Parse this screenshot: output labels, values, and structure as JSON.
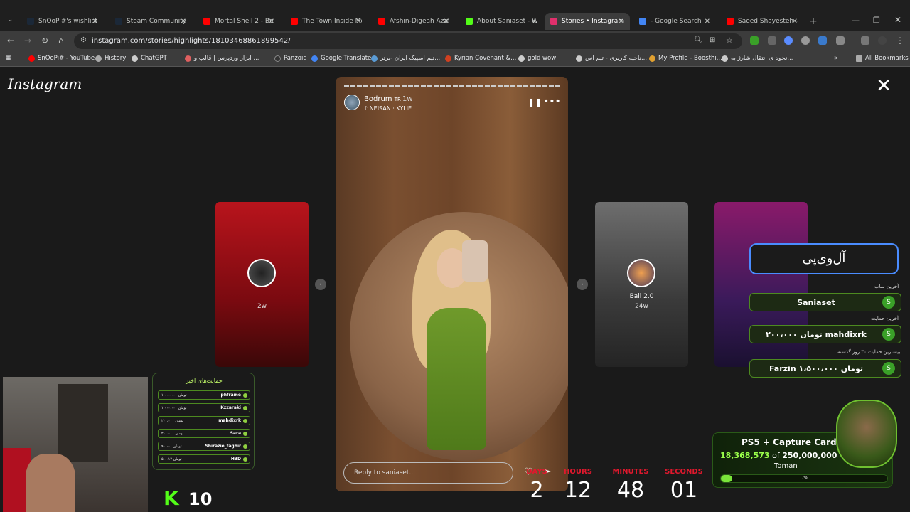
{
  "tabs": [
    {
      "label": "SnOoPi#'s wishlist",
      "color": "#1b2838"
    },
    {
      "label": "Steam Community ::",
      "color": "#1b2838"
    },
    {
      "label": "Mortal Shell 2 - Befo",
      "color": "#ff0000"
    },
    {
      "label": "The Town Inside Me |",
      "color": "#ff0000"
    },
    {
      "label": "Afshin-Digeah Azat B",
      "color": "#ff0000"
    },
    {
      "label": "About Saniaset - Wa",
      "color": "#53fc18"
    },
    {
      "label": "Stories • Instagram",
      "color": "#e1306c"
    },
    {
      "label": "- Google Search",
      "color": "#4285f4"
    },
    {
      "label": "Saeed Shayesteh - S",
      "color": "#ff0000"
    }
  ],
  "address": {
    "url": "instagram.com/stories/highlights/18103468861899542/"
  },
  "bookmarks": [
    {
      "label": "SnOoPi# - YouTube",
      "color": "#ff0000"
    },
    {
      "label": "History",
      "color": "#aaaaaa"
    },
    {
      "label": "ChatGPT",
      "color": "#cccccc"
    },
    {
      "label": "ابزار وردپرس | قالب و ...",
      "color": "#e06060"
    },
    {
      "label": "Panzoid",
      "color": "#333333"
    },
    {
      "label": "Google Translate",
      "color": "#4285f4"
    },
    {
      "label": "تیم اسپیک ایران -برتر...",
      "color": "#5a9bd5"
    },
    {
      "label": "Kyrian Covenant &...",
      "color": "#d04020"
    },
    {
      "label": "gold wow",
      "color": "#cccccc"
    },
    {
      "label": "ناحیه کاربری - تیم اس...",
      "color": "#cccccc"
    },
    {
      "label": "My Profile - Boosthi...",
      "color": "#e0a030"
    },
    {
      "label": "نحوه ی انتقال شارژ به...",
      "color": "#cccccc"
    }
  ],
  "all_bookmarks": "All Bookmarks",
  "instagram": {
    "logo": "Instagram",
    "story": {
      "username": "Bodrum",
      "flag": "TR",
      "time": "1w",
      "music": "NEISAN · KYLIE",
      "reply_placeholder": "Reply to saniaset..."
    },
    "left_story": {
      "time": "2w"
    },
    "right_story": {
      "name": "Bali 2.0",
      "time": "24w"
    }
  },
  "overlay": {
    "title": "آل‌وی‌پی",
    "last_sub_label": "آخرین ساب",
    "last_sub": "Saniaset",
    "last_donation_label": "آخرین حمایت",
    "last_donation": "۲۰۰،۰۰۰ تومان  mahdixrk",
    "top_donation_label": "بیشترین حمایت ۳۰ روز گذشته",
    "top_donation": "Farzin  ۱،۵۰۰،۰۰۰ تومان",
    "recent_title": "حمایت‌های اخیر",
    "recent": [
      {
        "name": "phframe",
        "amount": "۱،۰۰۰،۰۰۰ تومان"
      },
      {
        "name": "Kzzaraki",
        "amount": "۱،۰۰۰،۰۰۰ تومان"
      },
      {
        "name": "mahdixrk",
        "amount": "۲۰۰،۰۰۰ تومان"
      },
      {
        "name": "Sara",
        "amount": "۲۰۰،۰۰۰ تومان"
      },
      {
        "name": "Shirazie_faghir",
        "amount": "۹۰،۰۰۰ تومان"
      },
      {
        "name": "H3D",
        "amount": "۵۰،۰۱۷ تومان"
      }
    ],
    "kick_logo": "K",
    "viewers": "10",
    "timer": [
      {
        "label": "DAYS",
        "value": "2"
      },
      {
        "label": "HOURS",
        "value": "12"
      },
      {
        "label": "MINUTES",
        "value": "48"
      },
      {
        "label": "SECONDS",
        "value": "01"
      }
    ],
    "goal": {
      "title": "PS5 + Capture Card",
      "current": "18,368,573",
      "of": "of",
      "target": "250,000,000",
      "unit": "Toman",
      "percent_label": "7%",
      "fraction": 0.07
    }
  }
}
